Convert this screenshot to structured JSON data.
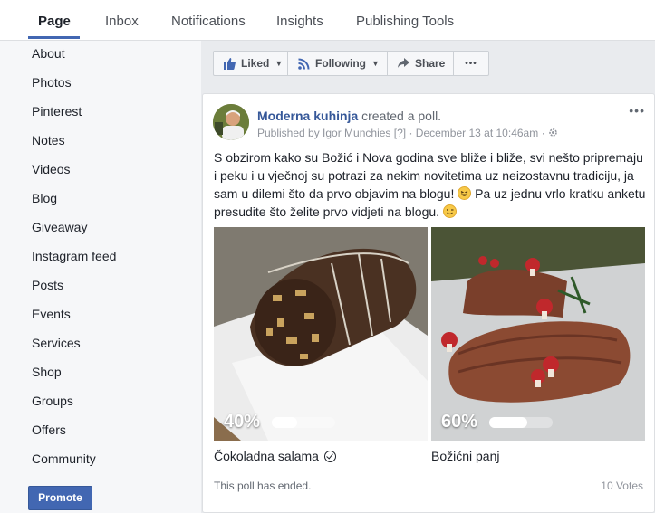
{
  "tabs": [
    {
      "label": "Page",
      "active": true
    },
    {
      "label": "Inbox"
    },
    {
      "label": "Notifications"
    },
    {
      "label": "Insights"
    },
    {
      "label": "Publishing Tools"
    }
  ],
  "sidebar": {
    "items": [
      "About",
      "Photos",
      "Pinterest",
      "Notes",
      "Videos",
      "Blog",
      "Giveaway",
      "Instagram feed",
      "Posts",
      "Events",
      "Services",
      "Shop",
      "Groups",
      "Offers",
      "Community"
    ],
    "promote_label": "Promote"
  },
  "actions": {
    "liked": "Liked",
    "following": "Following",
    "share": "Share",
    "more": "•••"
  },
  "post": {
    "page_name": "Moderna kuhinja",
    "action": "created a poll.",
    "published_by": "Published by Igor Munchies",
    "info_mark": "[?]",
    "separator": "·",
    "date": "December 13 at 10:46am",
    "menu": "•••",
    "text_1": "S obzirom kako su Božić i Nova godina sve bliže i bliže, svi nešto pripremaju i peku i u vječnoj su potrazi za nekim novitetima uz neizostavnu tradiciju, ja sam u dilemi što da prvo objavim na blogu!",
    "text_2": "Pa uz jednu vrlo kratku anketu presudite što želite prvo vidjeti na blogu.",
    "poll": {
      "options": [
        {
          "label": "Čokoladna salama",
          "percent_label": "40%",
          "percent": 40,
          "selected": true
        },
        {
          "label": "Božićni panj",
          "percent_label": "60%",
          "percent": 60,
          "selected": false
        }
      ],
      "status": "This poll has ended.",
      "votes": "10 Votes"
    }
  },
  "colors": {
    "brand_blue": "#4267b2",
    "link_blue": "#365899",
    "background": "#e9ebee"
  }
}
